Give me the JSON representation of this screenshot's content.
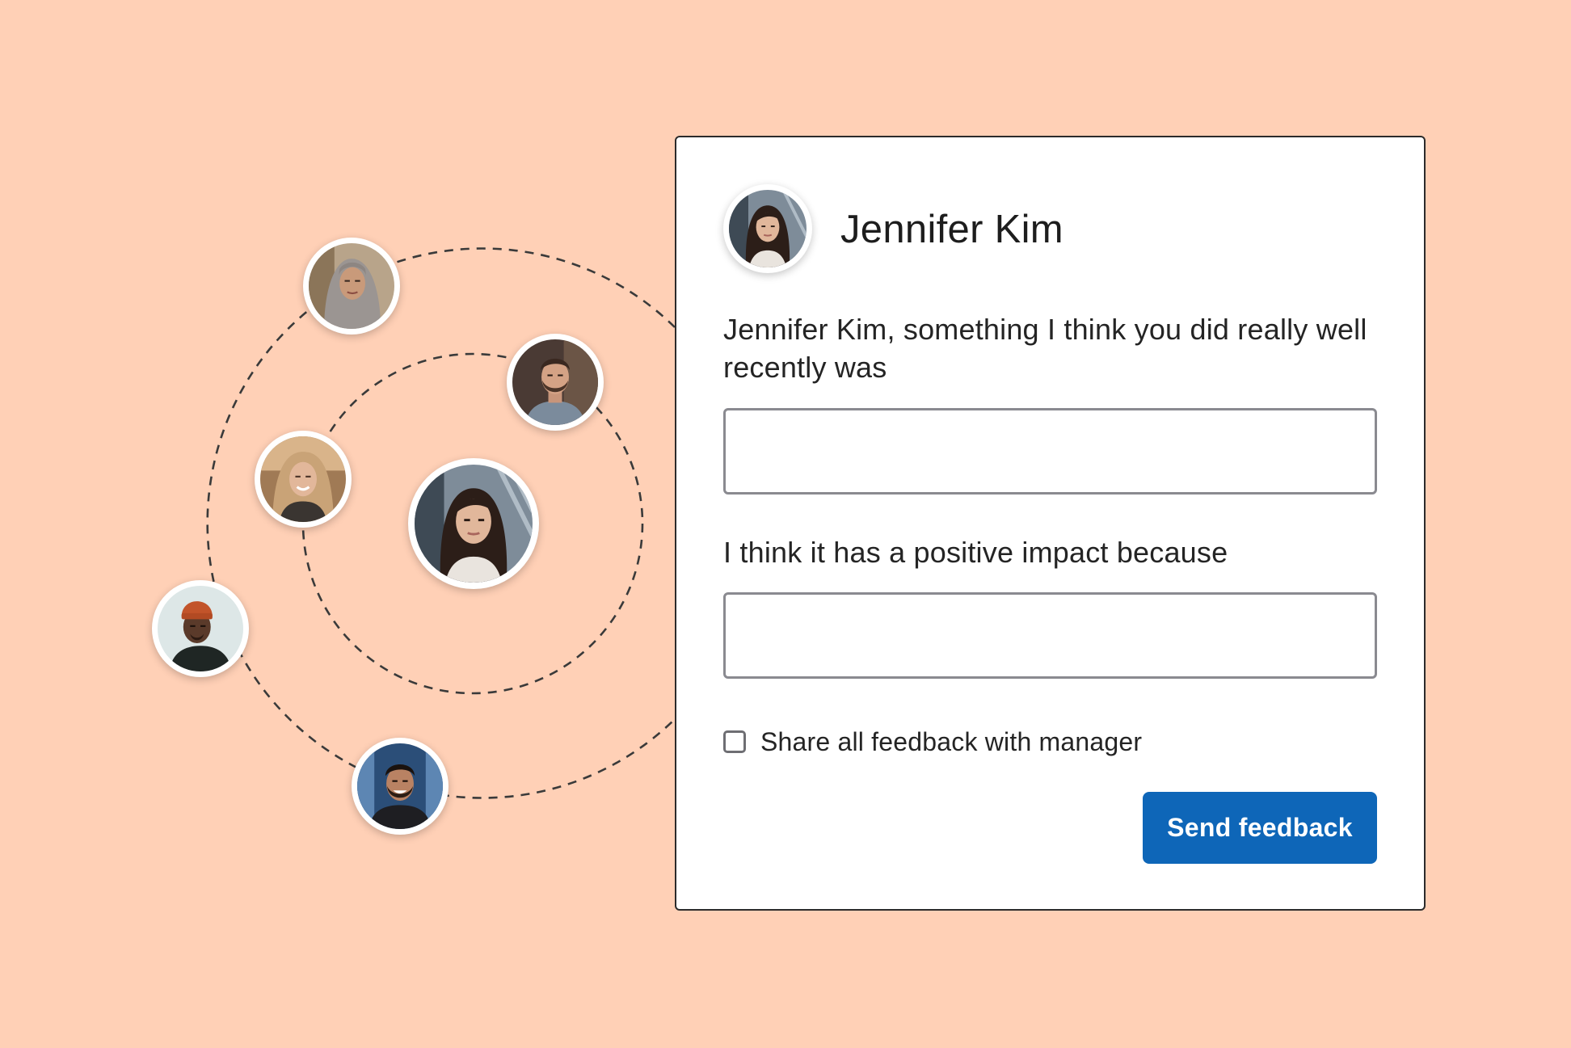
{
  "colors": {
    "background": "#FFD0B6",
    "card": "#FFFFFF",
    "primary_button": "#0E66B8",
    "dashed_orbit": "#3a3a3a"
  },
  "people_network": {
    "avatars": [
      {
        "id": "woman-headscarf",
        "icon": "person-avatar-icon"
      },
      {
        "id": "man-beard",
        "icon": "person-avatar-icon"
      },
      {
        "id": "woman-blonde",
        "icon": "person-avatar-icon"
      },
      {
        "id": "jennifer-kim",
        "icon": "person-avatar-icon"
      },
      {
        "id": "man-orange-beanie",
        "icon": "person-avatar-icon"
      },
      {
        "id": "man-smiling",
        "icon": "person-avatar-icon"
      }
    ]
  },
  "feedback_card": {
    "recipient_name": "Jennifer Kim",
    "prompt_1": "Jennifer Kim, something I think you did really well recently was",
    "field_1_value": "",
    "prompt_2": "I think it has a positive impact because",
    "field_2_value": "",
    "share_checkbox_label": "Share all feedback with manager",
    "share_checkbox_checked": false,
    "send_button_label": "Send feedback"
  }
}
